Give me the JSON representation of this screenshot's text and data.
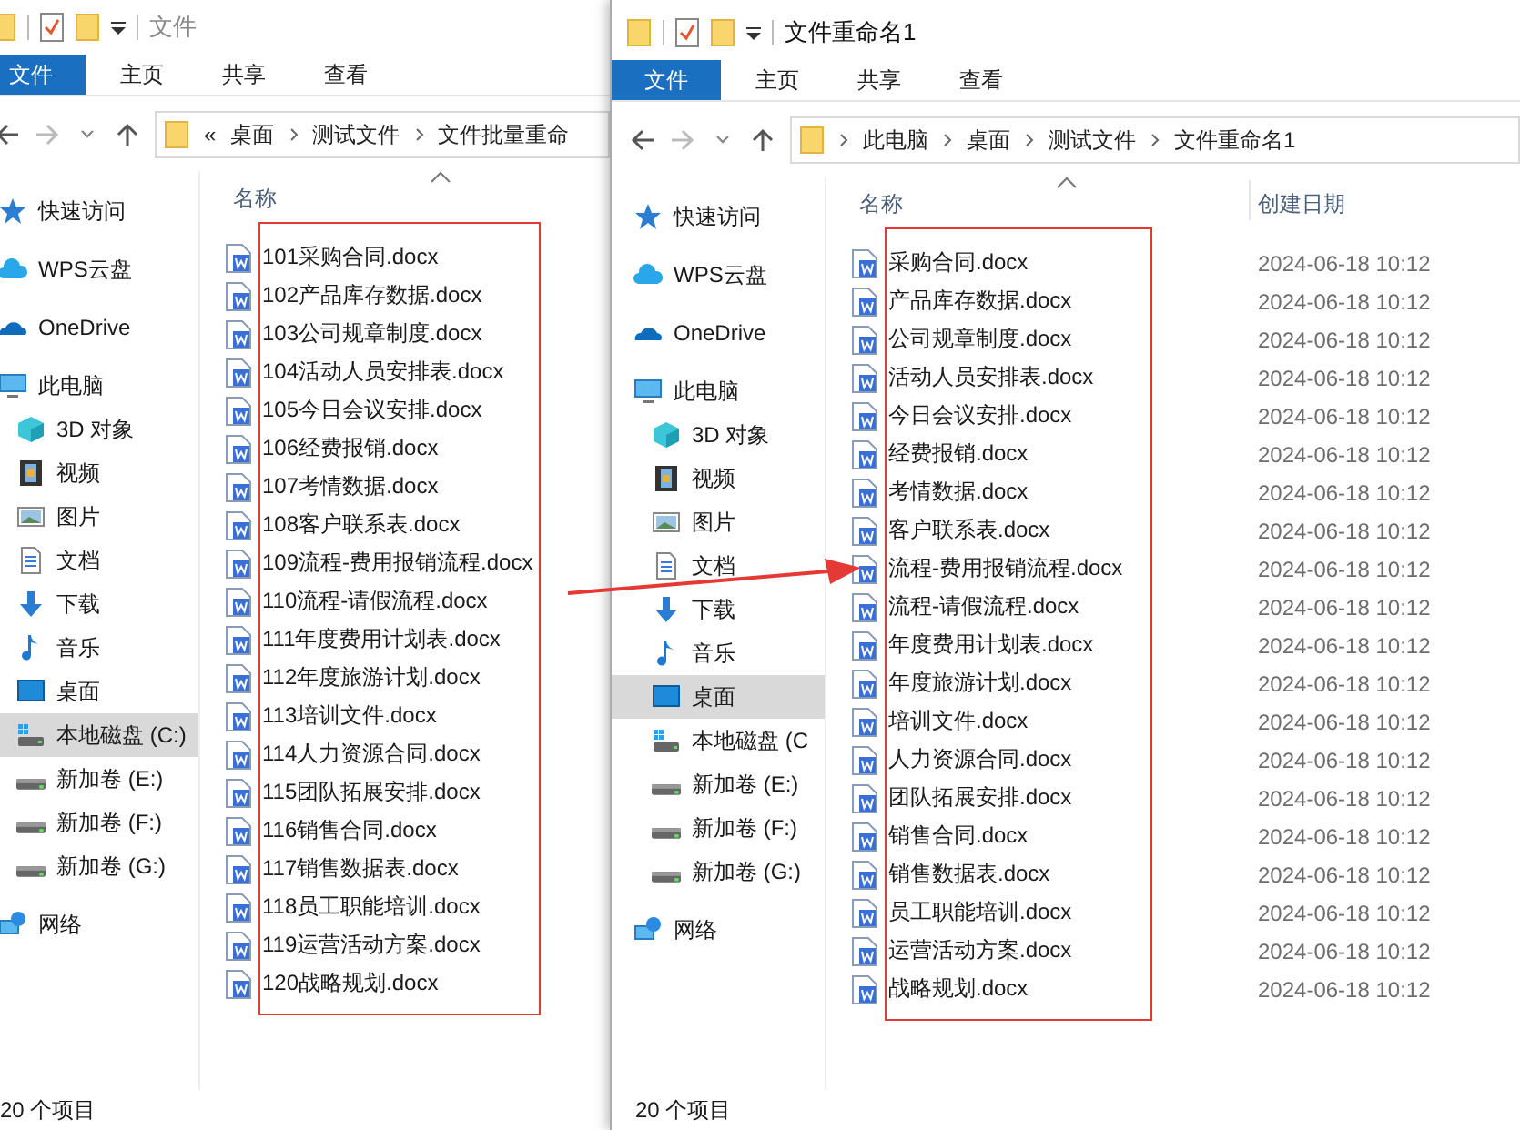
{
  "windows": [
    {
      "title": "文件",
      "ribbon": [
        {
          "label": "文件",
          "kind": "file-menu"
        },
        {
          "label": "主页",
          "kind": "tab"
        },
        {
          "label": "共享",
          "kind": "tab"
        },
        {
          "label": "查看",
          "kind": "tab"
        }
      ],
      "breadcrumb": {
        "overflow": "«",
        "parts": [
          "桌面",
          "测试文件",
          "文件批量重命"
        ]
      },
      "sidebar": [
        {
          "label": "快速访问",
          "kind": "star",
          "selected": false
        },
        {
          "label": "WPS云盘",
          "kind": "wps-cloud",
          "selected": false
        },
        {
          "label": "OneDrive",
          "kind": "onedrive",
          "selected": false
        },
        {
          "label": "此电脑",
          "kind": "pc",
          "selected": false,
          "children": [
            {
              "label": "3D 对象",
              "kind": "cube",
              "selected": false
            },
            {
              "label": "视频",
              "kind": "video",
              "selected": false
            },
            {
              "label": "图片",
              "kind": "picture",
              "selected": false
            },
            {
              "label": "文档",
              "kind": "document",
              "selected": false
            },
            {
              "label": "下载",
              "kind": "download",
              "selected": false
            },
            {
              "label": "音乐",
              "kind": "music",
              "selected": false
            },
            {
              "label": "桌面",
              "kind": "desktop",
              "selected": false
            },
            {
              "label": "本地磁盘 (C:)",
              "kind": "system-disk",
              "selected": true
            },
            {
              "label": "新加卷 (E:)",
              "kind": "disk",
              "selected": false
            },
            {
              "label": "新加卷 (F:)",
              "kind": "disk",
              "selected": false
            },
            {
              "label": "新加卷 (G:)",
              "kind": "disk",
              "selected": false
            }
          ]
        },
        {
          "label": "网络",
          "kind": "network",
          "selected": false
        }
      ],
      "columns": [
        {
          "label": "名称",
          "sorted": true
        }
      ],
      "files": [
        {
          "name": "101采购合同.docx"
        },
        {
          "name": "102产品库存数据.docx"
        },
        {
          "name": "103公司规章制度.docx"
        },
        {
          "name": "104活动人员安排表.docx"
        },
        {
          "name": "105今日会议安排.docx"
        },
        {
          "name": "106经费报销.docx"
        },
        {
          "name": "107考情数据.docx"
        },
        {
          "name": "108客户联系表.docx"
        },
        {
          "name": "109流程-费用报销流程.docx"
        },
        {
          "name": "110流程-请假流程.docx"
        },
        {
          "name": "111年度费用计划表.docx"
        },
        {
          "name": "112年度旅游计划.docx"
        },
        {
          "name": "113培训文件.docx"
        },
        {
          "name": "114人力资源合同.docx"
        },
        {
          "name": "115团队拓展安排.docx"
        },
        {
          "name": "116销售合同.docx"
        },
        {
          "name": "117销售数据表.docx"
        },
        {
          "name": "118员工职能培训.docx"
        },
        {
          "name": "119运营活动方案.docx"
        },
        {
          "name": "120战略规划.docx"
        }
      ],
      "highlighted": true,
      "status": "20 个项目"
    },
    {
      "title": "文件重命名1",
      "ribbon": [
        {
          "label": "文件",
          "kind": "file-menu"
        },
        {
          "label": "主页",
          "kind": "tab"
        },
        {
          "label": "共享",
          "kind": "tab"
        },
        {
          "label": "查看",
          "kind": "tab"
        }
      ],
      "breadcrumb": {
        "parts": [
          "此电脑",
          "桌面",
          "测试文件",
          "文件重命名1"
        ]
      },
      "sidebar": [
        {
          "label": "快速访问",
          "kind": "star",
          "selected": false
        },
        {
          "label": "WPS云盘",
          "kind": "wps-cloud",
          "selected": false
        },
        {
          "label": "OneDrive",
          "kind": "onedrive",
          "selected": false
        },
        {
          "label": "此电脑",
          "kind": "pc",
          "selected": false,
          "children": [
            {
              "label": "3D 对象",
              "kind": "cube",
              "selected": false
            },
            {
              "label": "视频",
              "kind": "video",
              "selected": false
            },
            {
              "label": "图片",
              "kind": "picture",
              "selected": false
            },
            {
              "label": "文档",
              "kind": "document",
              "selected": false
            },
            {
              "label": "下载",
              "kind": "download",
              "selected": false
            },
            {
              "label": "音乐",
              "kind": "music",
              "selected": false
            },
            {
              "label": "桌面",
              "kind": "desktop",
              "selected": true
            },
            {
              "label": "本地磁盘 (C",
              "kind": "system-disk",
              "selected": false
            },
            {
              "label": "新加卷 (E:)",
              "kind": "disk",
              "selected": false
            },
            {
              "label": "新加卷 (F:)",
              "kind": "disk",
              "selected": false
            },
            {
              "label": "新加卷 (G:)",
              "kind": "disk",
              "selected": false
            }
          ]
        },
        {
          "label": "网络",
          "kind": "network",
          "selected": false
        }
      ],
      "columns": [
        {
          "label": "名称",
          "sorted": true
        },
        {
          "label": "创建日期",
          "sorted": false
        }
      ],
      "files": [
        {
          "name": "采购合同.docx",
          "created": "2024-06-18 10:12"
        },
        {
          "name": "产品库存数据.docx",
          "created": "2024-06-18 10:12"
        },
        {
          "name": "公司规章制度.docx",
          "created": "2024-06-18 10:12"
        },
        {
          "name": "活动人员安排表.docx",
          "created": "2024-06-18 10:12"
        },
        {
          "name": "今日会议安排.docx",
          "created": "2024-06-18 10:12"
        },
        {
          "name": "经费报销.docx",
          "created": "2024-06-18 10:12"
        },
        {
          "name": "考情数据.docx",
          "created": "2024-06-18 10:12"
        },
        {
          "name": "客户联系表.docx",
          "created": "2024-06-18 10:12"
        },
        {
          "name": "流程-费用报销流程.docx",
          "created": "2024-06-18 10:12"
        },
        {
          "name": "流程-请假流程.docx",
          "created": "2024-06-18 10:12"
        },
        {
          "name": "年度费用计划表.docx",
          "created": "2024-06-18 10:12"
        },
        {
          "name": "年度旅游计划.docx",
          "created": "2024-06-18 10:12"
        },
        {
          "name": "培训文件.docx",
          "created": "2024-06-18 10:12"
        },
        {
          "name": "人力资源合同.docx",
          "created": "2024-06-18 10:12"
        },
        {
          "name": "团队拓展安排.docx",
          "created": "2024-06-18 10:12"
        },
        {
          "name": "销售合同.docx",
          "created": "2024-06-18 10:12"
        },
        {
          "name": "销售数据表.docx",
          "created": "2024-06-18 10:12"
        },
        {
          "name": "员工职能培训.docx",
          "created": "2024-06-18 10:12"
        },
        {
          "name": "运营活动方案.docx",
          "created": "2024-06-18 10:12"
        },
        {
          "name": "战略规划.docx",
          "created": "2024-06-18 10:12"
        }
      ],
      "highlighted": true,
      "status": "20 个项目"
    }
  ],
  "arrow": true
}
